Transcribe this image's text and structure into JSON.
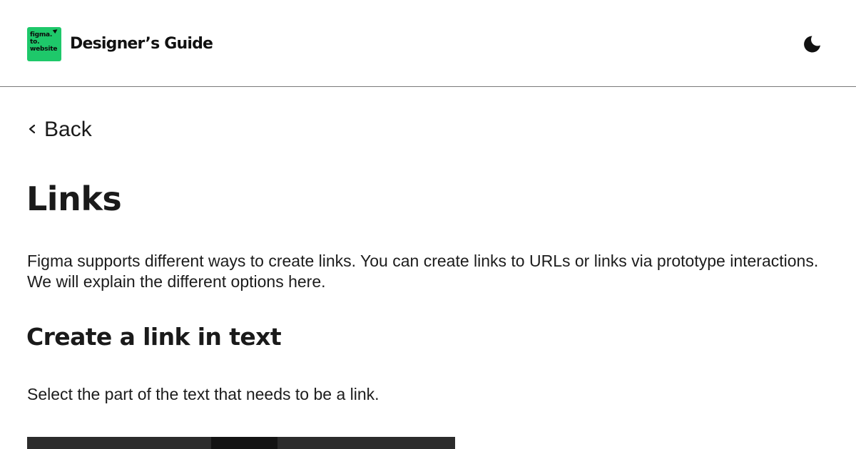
{
  "header": {
    "logo": {
      "lines": [
        "figma.",
        "to.",
        "website"
      ],
      "color": "#1ec86a"
    },
    "site_title": "Designer’s Guide",
    "theme_toggle_icon": "moon-icon"
  },
  "nav": {
    "back_label": "Back",
    "back_icon": "chevron-left-icon"
  },
  "main": {
    "title": "Links",
    "intro": "Figma supports different ways to create links. You can create links to URLs or links via prototype interactions. We will explain the different options here.",
    "section_title": "Create a link in text",
    "instruction": "Select the part of the text that needs to be a link."
  }
}
